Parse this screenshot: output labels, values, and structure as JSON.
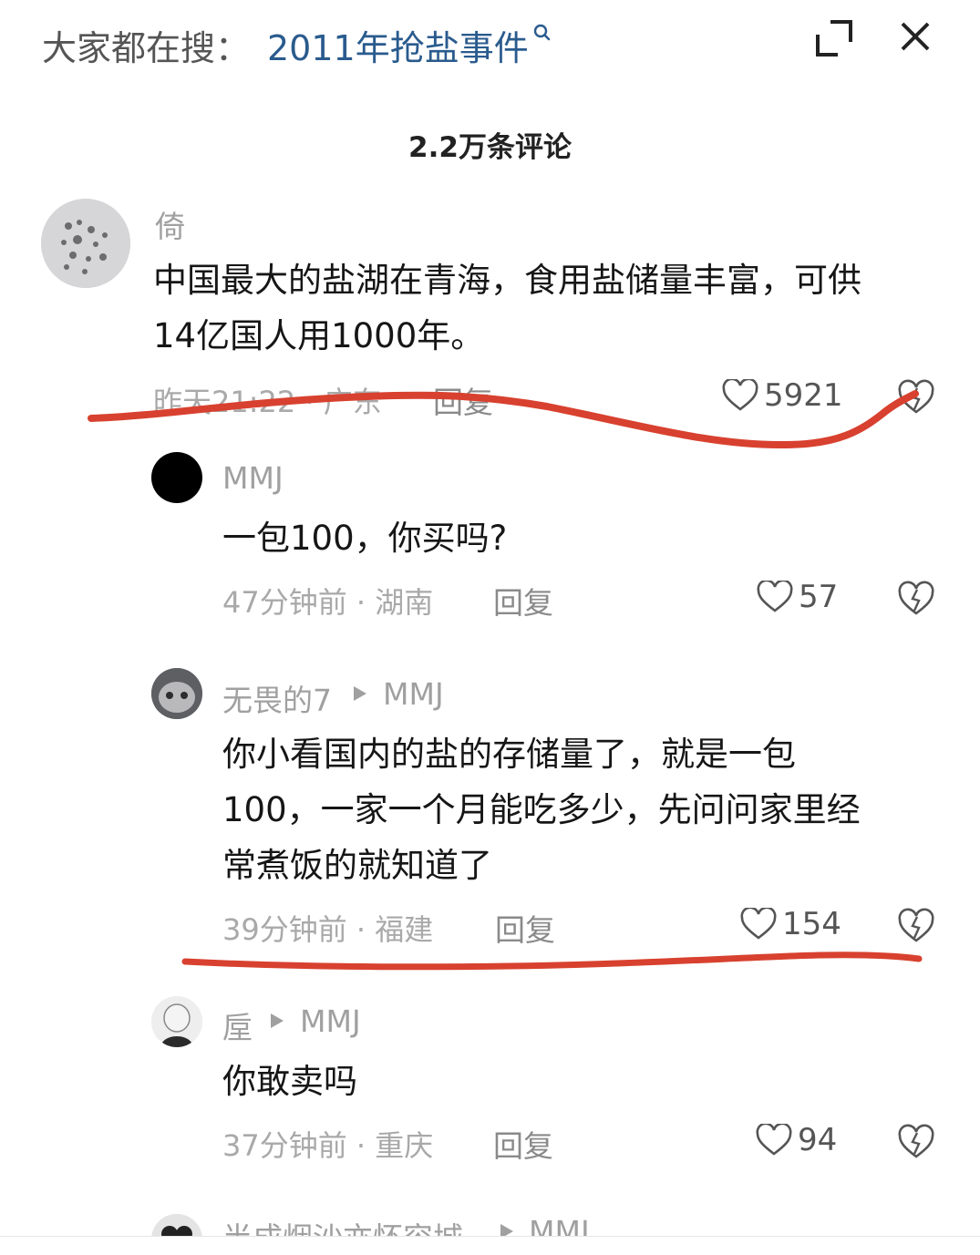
{
  "header": {
    "search_prefix": "大家都在搜：",
    "search_term": "2011年抢盐事件",
    "search_icon": "search-icon",
    "expand_icon": "expand-icon",
    "close_icon": "close-icon"
  },
  "comment_count": "2.2万条评论",
  "comments": [
    {
      "user": "倚",
      "text_line1": "中国最大的盐湖在青海，食用盐储量丰富，可供",
      "text_line2": "14亿国人用1000年。",
      "meta": "昨天21:22 · 广东",
      "reply": "回复",
      "likes": "5921"
    },
    {
      "user": "MMJ",
      "text_line1": "一包100，你买吗?",
      "meta": "47分钟前 · 湖南",
      "reply": "回复",
      "likes": "57"
    },
    {
      "user": "无畏的7",
      "reply_to": "MMJ",
      "text_line1": "你小看国内的盐的存储量了，就是一包",
      "text_line2": "100，一家一个月能吃多少，先问问家里经",
      "text_line3": "常煮饭的就知道了",
      "meta": "39分钟前 · 福建",
      "reply": "回复",
      "likes": "154"
    },
    {
      "user": "垕",
      "reply_to": "MMJ",
      "text_line1": "你敢卖吗",
      "meta": "37分钟前 · 重庆",
      "reply": "回复",
      "likes": "94"
    },
    {
      "user": "半成烟沙亦怀容城",
      "reply_to": "MMJ"
    }
  ],
  "colors": {
    "link": "#2a5b8e",
    "annotation_red": "#d8412f",
    "muted": "#a9a9a9"
  }
}
